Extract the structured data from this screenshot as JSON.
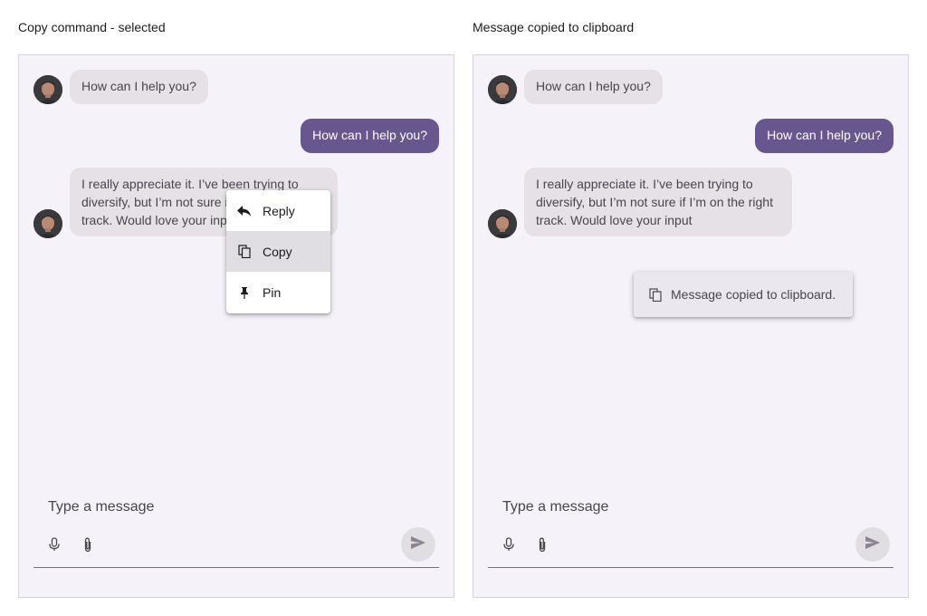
{
  "captions": {
    "left": "Copy command - selected",
    "right": "Message copied to clipboard"
  },
  "messages": {
    "incoming_1": "How can I help you?",
    "outgoing_1": "How can I help you?",
    "incoming_2": "I really appreciate it. I’ve been trying to diversify, but I’m not sure if I’m on the right track. Would love your input"
  },
  "context_menu": {
    "items": [
      {
        "label": "Reply",
        "icon": "reply-icon"
      },
      {
        "label": "Copy",
        "icon": "copy-icon",
        "selected": true
      },
      {
        "label": "Pin",
        "icon": "pin-icon"
      }
    ]
  },
  "toast": {
    "text": "Message copied to clipboard.",
    "icon": "copy-icon"
  },
  "composer": {
    "placeholder": "Type a message",
    "icons": [
      "mic-icon",
      "attach-icon",
      "send-icon"
    ]
  },
  "colors": {
    "outgoing_bubble": "#68578f",
    "incoming_bubble": "#e5e1e7",
    "panel_bg": "#f5f2f9"
  }
}
